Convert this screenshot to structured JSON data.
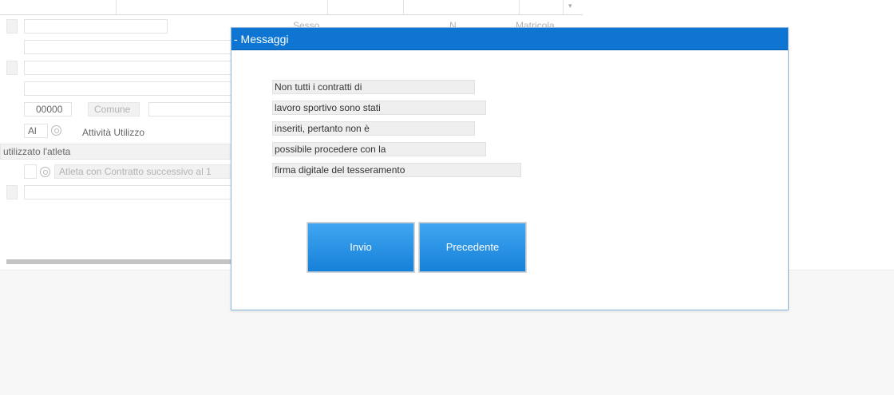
{
  "background_form": {
    "sesso_label": "Sesso",
    "n_label": "N",
    "matricola_label": "Matricola",
    "cap_value": "00000",
    "comune_label": "Comune",
    "al_label": "Al",
    "attivita_label": "Attività Utilizzo",
    "section_label": "utilizzato l'atleta",
    "contratto_label": "Atleta con Contratto successivo al 1"
  },
  "dialog": {
    "title": "- Messaggi",
    "message_lines": [
      "Non tutti i contratti di",
      "lavoro sportivo sono stati",
      "inseriti, pertanto non è",
      "possibile procedere con la",
      "firma digitale del tesseramento"
    ],
    "buttons": {
      "submit_label": "Invio",
      "back_label": "Precedente"
    }
  },
  "colors": {
    "header_blue": "#0e76d2",
    "button_blue": "#1a86dc"
  }
}
